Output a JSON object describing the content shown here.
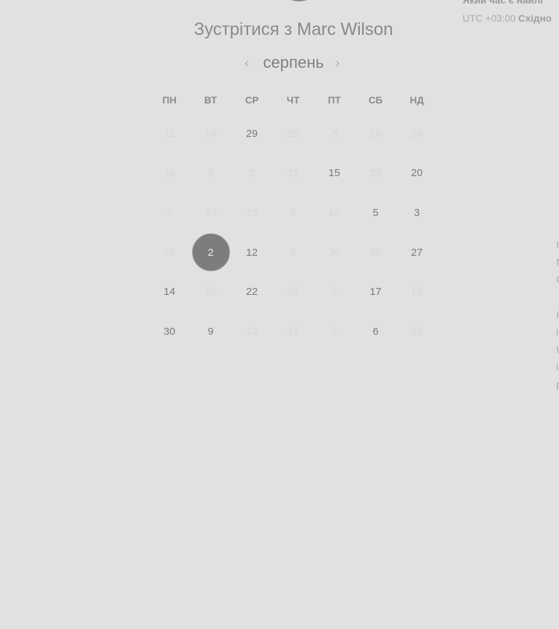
{
  "header": {
    "title_prefix": "Зустрітися з",
    "host_name": "Marc Wilson"
  },
  "calendar": {
    "month": "серпень",
    "prev_icon": "chevron-left-icon",
    "next_icon": "chevron-right-icon",
    "prev": "‹",
    "next": "›",
    "weekdays": [
      "ПН",
      "ВТ",
      "СР",
      "ЧТ",
      "ПТ",
      "СБ",
      "НД"
    ],
    "selected": "2",
    "weeks": [
      [
        {
          "d": "11",
          "a": false
        },
        {
          "d": "14",
          "a": false
        },
        {
          "d": "29",
          "a": true
        },
        {
          "d": "20",
          "a": false
        },
        {
          "d": "8",
          "a": false
        },
        {
          "d": "10",
          "a": false
        },
        {
          "d": "24",
          "a": false
        }
      ],
      [
        {
          "d": "18",
          "a": false
        },
        {
          "d": "6",
          "a": false
        },
        {
          "d": "2",
          "a": false
        },
        {
          "d": "13",
          "a": false
        },
        {
          "d": "15",
          "a": true
        },
        {
          "d": "24",
          "a": false
        },
        {
          "d": "20",
          "a": true
        }
      ],
      [
        {
          "d": "7",
          "a": false
        },
        {
          "d": "30",
          "a": false
        },
        {
          "d": "13",
          "a": false
        },
        {
          "d": "4",
          "a": false
        },
        {
          "d": "16",
          "a": false
        },
        {
          "d": "5",
          "a": true
        },
        {
          "d": "3",
          "a": true
        }
      ],
      [
        {
          "d": "28",
          "a": false
        },
        {
          "d": "2",
          "a": true,
          "sel": true
        },
        {
          "d": "12",
          "a": true
        },
        {
          "d": "5",
          "a": false
        },
        {
          "d": "30",
          "a": false
        },
        {
          "d": "26",
          "a": false
        },
        {
          "d": "27",
          "a": true
        }
      ],
      [
        {
          "d": "14",
          "a": true
        },
        {
          "d": "22",
          "a": false
        },
        {
          "d": "22",
          "a": true
        },
        {
          "d": "25",
          "a": false
        },
        {
          "d": "1",
          "a": false
        },
        {
          "d": "17",
          "a": true
        },
        {
          "d": "18",
          "a": false
        }
      ],
      [
        {
          "d": "30",
          "a": true
        },
        {
          "d": "9",
          "a": true
        },
        {
          "d": "13",
          "a": false
        },
        {
          "d": "16",
          "a": false
        },
        {
          "d": "1",
          "a": false
        },
        {
          "d": "6",
          "a": true
        },
        {
          "d": "20",
          "a": false
        }
      ]
    ]
  },
  "right_panel": {
    "question": "Який час є найлі",
    "tz_offset": "UTC +03:00",
    "tz_name": "Східно",
    "clipped_letters": [
      "I",
      "N",
      "C",
      "I",
      "i",
      "U",
      "i",
      "p"
    ]
  }
}
